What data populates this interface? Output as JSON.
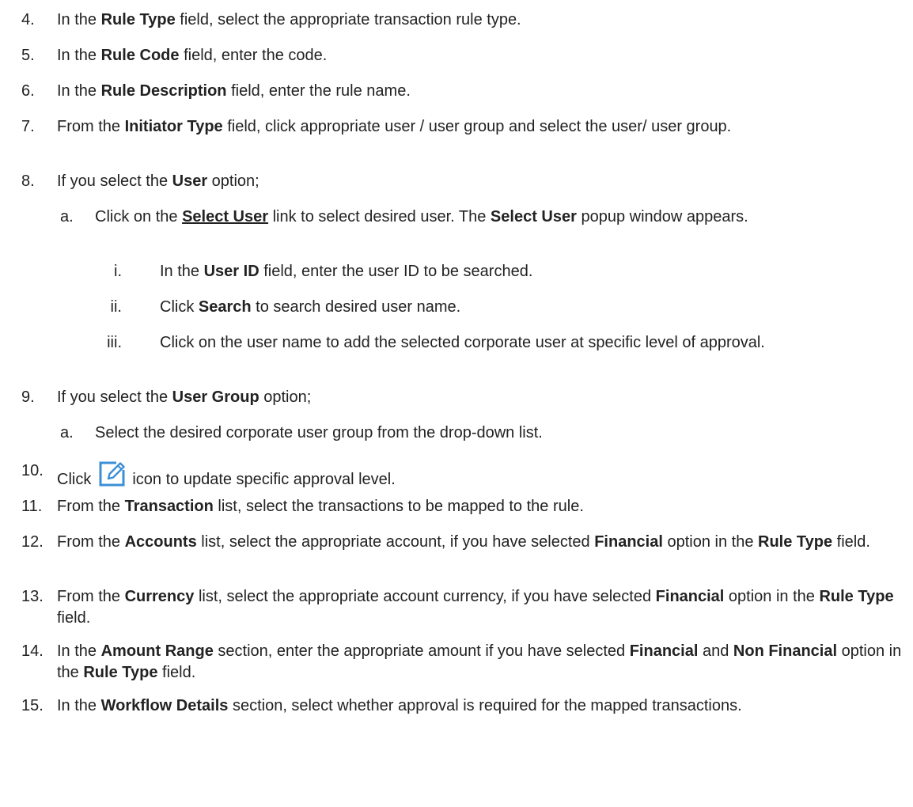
{
  "steps": [
    {
      "num": "4.",
      "parts": [
        {
          "t": "In the "
        },
        {
          "t": "Rule Type",
          "b": true
        },
        {
          "t": " field, select the appropriate transaction rule type."
        }
      ]
    },
    {
      "num": "5.",
      "parts": [
        {
          "t": "In the "
        },
        {
          "t": "Rule Code",
          "b": true
        },
        {
          "t": " field, enter the code."
        }
      ]
    },
    {
      "num": "6.",
      "parts": [
        {
          "t": "In the "
        },
        {
          "t": "Rule Description",
          "b": true
        },
        {
          "t": " field, enter the rule name."
        }
      ]
    },
    {
      "num": "7.",
      "parts": [
        {
          "t": "From the "
        },
        {
          "t": "Initiator Type",
          "b": true
        },
        {
          "t": " field, click appropriate user / user group and select the user/ user group."
        }
      ]
    },
    {
      "num": "8.",
      "parts": [
        {
          "t": "If you select the "
        },
        {
          "t": "User",
          "b": true
        },
        {
          "t": " option;"
        }
      ]
    },
    {
      "num": "a.",
      "level": 1,
      "parts": [
        {
          "t": "Click on the "
        },
        {
          "t": "Select User",
          "link": true
        },
        {
          "t": " link to select desired user. The "
        },
        {
          "t": "Select User",
          "b": true
        },
        {
          "t": " popup window appears."
        }
      ]
    },
    {
      "num": "i.",
      "level": 2,
      "parts": [
        {
          "t": "In the "
        },
        {
          "t": "User ID",
          "b": true
        },
        {
          "t": " field, enter the user ID to be searched."
        }
      ]
    },
    {
      "num": "ii.",
      "level": 2,
      "parts": [
        {
          "t": "Click "
        },
        {
          "t": "Search",
          "b": true
        },
        {
          "t": " to search desired user name."
        }
      ]
    },
    {
      "num": "iii.",
      "level": 2,
      "parts": [
        {
          "t": "Click on the user name to add the selected corporate user at specific level of approval."
        }
      ]
    },
    {
      "num": "9.",
      "parts": [
        {
          "t": "If you select the "
        },
        {
          "t": "User Group",
          "b": true
        },
        {
          "t": " option;"
        }
      ]
    },
    {
      "num": "a.",
      "level": 1,
      "parts": [
        {
          "t": "Select the desired corporate user group from the drop-down list."
        }
      ]
    },
    {
      "num": "10.",
      "parts": [
        {
          "t": "Click"
        },
        {
          "icon": "edit-icon"
        },
        {
          "t": "icon to update specific approval level."
        }
      ]
    },
    {
      "num": "11.",
      "parts": [
        {
          "t": "From the "
        },
        {
          "t": "Transaction",
          "b": true
        },
        {
          "t": " list, select the transactions to be mapped to the rule."
        }
      ]
    },
    {
      "num": "12.",
      "parts": [
        {
          "t": "From the "
        },
        {
          "t": "Accounts",
          "b": true
        },
        {
          "t": " list, select the appropriate account, if you have selected "
        },
        {
          "t": "Financial",
          "b": true
        },
        {
          "t": " option in the "
        },
        {
          "t": "Rule Type",
          "b": true
        },
        {
          "t": " field."
        }
      ]
    },
    {
      "num": "13.",
      "parts": [
        {
          "t": "From the "
        },
        {
          "t": "Currency",
          "b": true
        },
        {
          "t": " list, select the appropriate account currency, if you have selected "
        },
        {
          "t": "Financial",
          "b": true
        },
        {
          "t": " option in the "
        },
        {
          "t": "Rule Type",
          "b": true
        },
        {
          "t": " field."
        }
      ]
    },
    {
      "num": "14.",
      "parts": [
        {
          "t": "In the "
        },
        {
          "t": "Amount Range",
          "b": true
        },
        {
          "t": " section, enter the appropriate amount if you have selected "
        },
        {
          "t": "Financial",
          "b": true
        },
        {
          "t": " and "
        },
        {
          "t": "Non Financial",
          "b": true
        },
        {
          "t": " option in the "
        },
        {
          "t": "Rule Type",
          "b": true
        },
        {
          "t": " field."
        }
      ]
    },
    {
      "num": "15.",
      "parts": [
        {
          "t": "In the "
        },
        {
          "t": "Workflow Details",
          "b": true
        },
        {
          "t": " section, select whether approval is required for the mapped transactions."
        }
      ]
    }
  ],
  "icon_color": "#3b8fd6"
}
